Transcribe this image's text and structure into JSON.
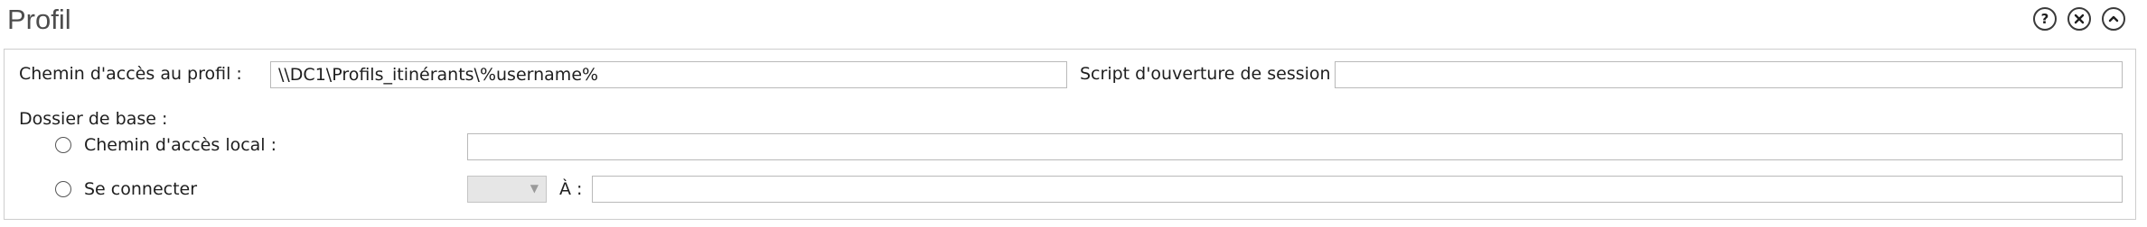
{
  "header": {
    "title": "Profil",
    "help_icon": "?",
    "close_icon": "✕",
    "collapse_icon": "^"
  },
  "profile": {
    "path_label": "Chemin d'accès au profil :",
    "path_value": "\\\\DC1\\Profils_itinérants\\%username%",
    "script_label": "Script d'ouverture de session",
    "script_value": ""
  },
  "home_folder": {
    "label": "Dossier de base :",
    "local_path_label": "Chemin d'accès local :",
    "local_path_value": "",
    "connect_label": "Se connecter",
    "drive_value": "",
    "to_label": "À :",
    "to_value": ""
  }
}
